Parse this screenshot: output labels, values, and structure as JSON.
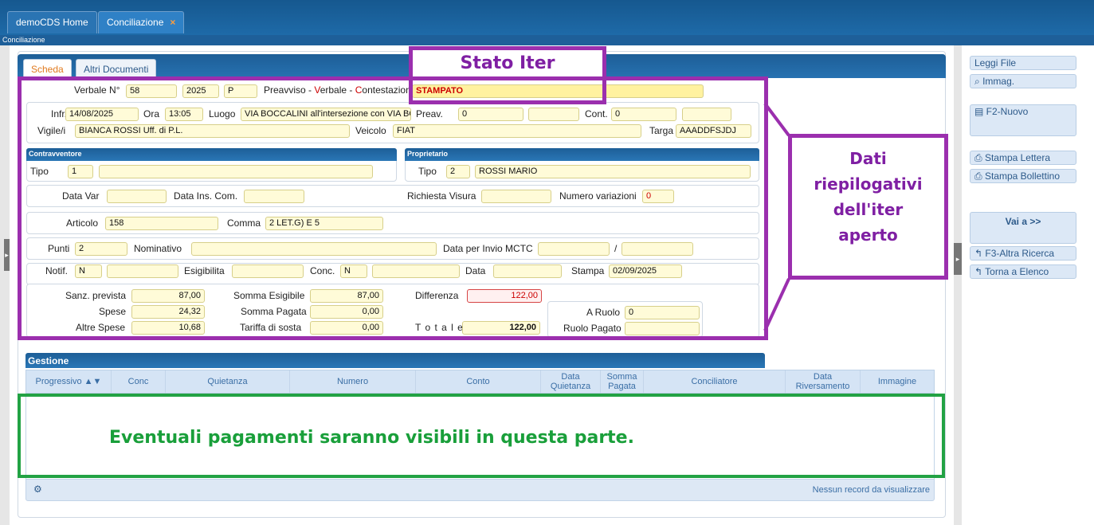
{
  "tabs": [
    {
      "label": "demoCDS Home"
    },
    {
      "label": "Conciliazione",
      "close": "×"
    }
  ],
  "breadcrumb": "Conciliazione",
  "subtabs": [
    "Scheda",
    "Altri Documenti"
  ],
  "annotations": {
    "stato_iter": "Stato Iter",
    "dati": [
      "Dati",
      "riepilogativi",
      "dell'iter",
      "aperto"
    ],
    "pagamenti": "Eventuali pagamenti saranno visibili in questa parte."
  },
  "form": {
    "verbale_label": "Verbale N°",
    "verbale_num": "58",
    "verbale_year": "2025",
    "verbale_type": "P",
    "preavviso_prefix": "Preavviso - ",
    "preavviso_v": "V",
    "preavviso_mid": "erbale - ",
    "preavviso_c": "C",
    "preavviso_suffix": "ontestazione",
    "stato": "STAMPATO",
    "infr_label": "Infr.",
    "infr": "14/08/2025",
    "ora_label": "Ora",
    "ora": "13:05",
    "luogo_label": "Luogo",
    "luogo": "VIA BOCCALINI all'intersezione con VIA BO",
    "preav_label": "Preav.",
    "preav": "0",
    "preav2": "",
    "cont_label": "Cont.",
    "cont": "0",
    "cont2": "",
    "vigile_label": "Vigile/i",
    "vigile": "BIANCA ROSSI Uff. di P.L.",
    "veicolo_label": "Veicolo",
    "veicolo": "FIAT",
    "targa_label": "Targa",
    "targa": "AAADDFSJDJ",
    "contravventore_title": "Contravventore",
    "proprietario_title": "Proprietario",
    "tipo_label": "Tipo",
    "contr_tipo": "1",
    "contr_nome": "",
    "prop_tipo": "2",
    "prop_nome": "ROSSI MARIO",
    "data_var_label": "Data Var",
    "data_ins_label": "Data Ins. Com.",
    "richiesta_label": "Richiesta Visura",
    "num_var_label": "Numero variazioni",
    "num_var": "0",
    "articolo_label": "Articolo",
    "articolo": "158",
    "comma_label": "Comma",
    "comma": "2 LET.G) E 5",
    "punti_label": "Punti",
    "punti": "2",
    "nominativo_label": "Nominativo",
    "data_mctc_label": "Data per Invio MCTC",
    "slash": "/",
    "notif_label": "Notif.",
    "notif": "N",
    "esig_label": "Esigibilita",
    "conc_label": "Conc.",
    "conc": "N",
    "data_label": "Data",
    "stampa_label": "Stampa",
    "stampa": "02/09/2025",
    "sanz_label": "Sanz. prevista",
    "sanz": "87,00",
    "spese_label": "Spese",
    "spese": "24,32",
    "altre_label": "Altre Spese",
    "altre": "10,68",
    "somma_esig_label": "Somma Esigibile",
    "somma_esig": "87,00",
    "somma_pag_label": "Somma Pagata",
    "somma_pag": "0,00",
    "tariffa_label": "Tariffa di sosta",
    "tariffa": "0,00",
    "differenza_label": "Differenza",
    "differenza": "122,00",
    "totale_label": "T o t a l e",
    "totale": "122,00",
    "a_ruolo_label": "A Ruolo",
    "a_ruolo": "0",
    "ruolo_pagato_label": "Ruolo Pagato"
  },
  "gestione": {
    "title": "Gestione",
    "columns": [
      "Progressivo ▲▼",
      "Conc",
      "Quietanza",
      "Numero",
      "Conto",
      "Data Quietanza",
      "Somma Pagata",
      "Conciliatore",
      "Data Riversamento",
      "Immagine"
    ],
    "empty_text": "Nessun record da visualizzare"
  },
  "side_buttons": {
    "leggi": "Leggi File",
    "immag": "Immag.",
    "nuovo": "F2-Nuovo",
    "stampa_lettera": "Stampa Lettera",
    "stampa_bollettino": "Stampa Bollettino",
    "vai_a": "Vai a >>",
    "altra_ricerca": "F3-Altra Ricerca",
    "torna": "Torna a Elenco"
  },
  "colors": {
    "accent": "#1e6aa8",
    "annotation_purple": "#9b2fae",
    "annotation_green": "#22a244",
    "field_bg": "#fffbd8"
  }
}
